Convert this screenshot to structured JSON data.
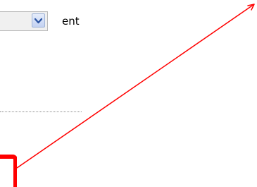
{
  "dropdown": {
    "label": "ent",
    "button_icon": "chevron-down-icon",
    "button_color": "#c3d2f2",
    "arrow_color": "#2d56a3"
  },
  "annotation": {
    "color": "#ff0000",
    "fragment_icon": "red-handwritten-fragment",
    "arrow_icon": "red-arrow-icon"
  }
}
